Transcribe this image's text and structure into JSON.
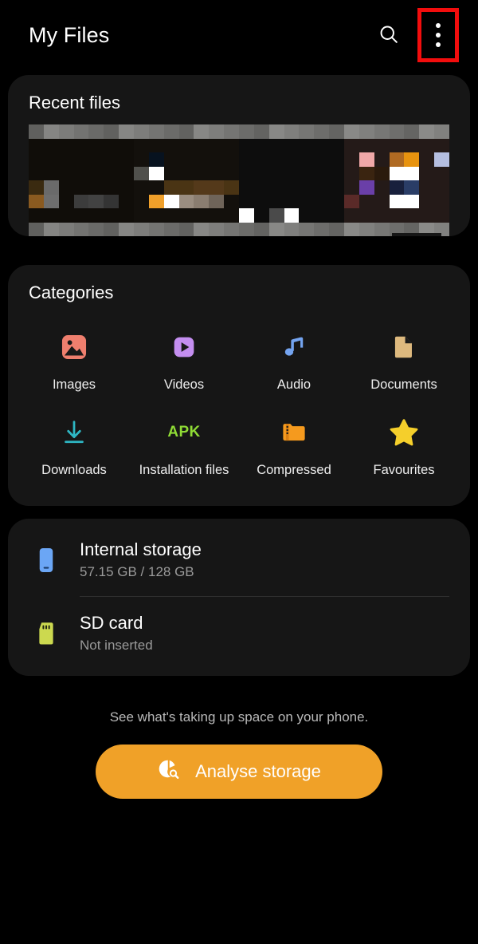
{
  "appbar": {
    "title": "My Files",
    "search_icon": "search-icon",
    "overflow_icon": "more-vertical-icon"
  },
  "recent": {
    "title": "Recent files"
  },
  "categories": {
    "title": "Categories",
    "items": [
      {
        "label": "Images",
        "icon": "image-icon",
        "color": "#ef7f6e"
      },
      {
        "label": "Videos",
        "icon": "video-play-icon",
        "color": "#c48ef0"
      },
      {
        "label": "Audio",
        "icon": "music-note-icon",
        "color": "#74a4f0"
      },
      {
        "label": "Documents",
        "icon": "document-icon",
        "color": "#ddb97e"
      },
      {
        "label": "Downloads",
        "icon": "download-icon",
        "color": "#2eb7c4"
      },
      {
        "label": "Installation\nfiles",
        "icon": "apk-icon",
        "color": "#8fdb35",
        "icon_text": "APK"
      },
      {
        "label": "Compressed",
        "icon": "folder-zip-icon",
        "color": "#f59a1e"
      },
      {
        "label": "Favourites",
        "icon": "star-icon",
        "color": "#f5cf2b"
      }
    ]
  },
  "storage": {
    "rows": [
      {
        "name": "Internal storage",
        "sub": "57.15 GB / 128 GB",
        "icon": "phone-icon",
        "color": "#6ba6f5"
      },
      {
        "name": "SD card",
        "sub": "Not inserted",
        "icon": "sd-card-icon",
        "color": "#ccd94f"
      }
    ]
  },
  "footer": {
    "hint": "See what's taking up space on your phone.",
    "button_label": "Analyse storage",
    "button_icon": "pie-chart-search-icon",
    "button_color": "#f0a128"
  },
  "highlight": {
    "color": "#f20d0d",
    "target": "more-vertical-icon"
  }
}
